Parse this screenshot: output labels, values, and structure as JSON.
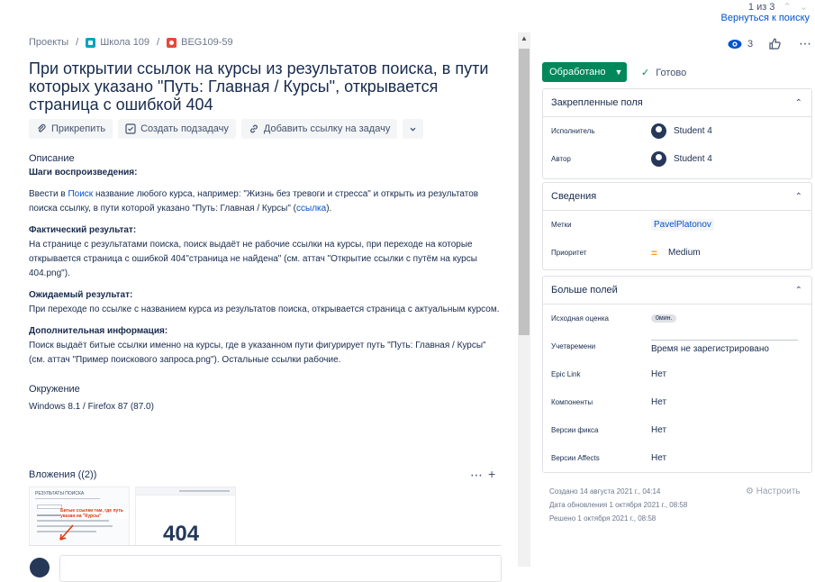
{
  "pager": {
    "position": "1 из 3",
    "back_label": "Вернуться к поиску"
  },
  "breadcrumb": {
    "projects": "Проекты",
    "project": "Школа 109",
    "issue_key": "BEG109-59"
  },
  "issue": {
    "title": "При открытии ссылок на курсы из результатов поиска, в пути которых указано \"Путь: Главная / Курсы\", открывается страница с ошибкой 404"
  },
  "actions": {
    "attach": "Прикрепить",
    "subtask": "Создать подзадачу",
    "link": "Добавить ссылку на задачу"
  },
  "description": {
    "heading": "Описание",
    "steps_heading": "Шаги воспроизведения:",
    "steps_1": "Ввести в ",
    "steps_link": "Поиск",
    "steps_2": " название любого курса, например: \"Жизнь без тревоги и стресса\" и открыть из результатов поиска ссылку, в пути которой указано \"Путь: Главная / Курсы\" (",
    "steps_link2": "ссылка",
    "steps_3": ").",
    "actual_heading": "Фактический результат:",
    "actual": "На странице с результатами поиска, поиск выдаёт не рабочие ссылки на курсы, при переходе на которые открывается страница с ошибкой 404\"страница не найдена\" (см. аттач \"Открытие ссылки с путём на курсы 404.png\").",
    "expected_heading": "Ожидаемый результат:",
    "expected": "При переходе по ссылке с названием курса из результатов поиска, открывается страница с актуальным курсом.",
    "extra_heading": "Дополнительная информация:",
    "extra": "Поиск выдаёт битые ссылки именно на курсы, где в указанном пути фигурирует путь \"Путь: Главная / Курсы\" (см. аттач \"Пример поискового запроса.png\"). Остальные ссылки рабочие."
  },
  "environment": {
    "heading": "Окружение",
    "value": "Windows 8.1 / Firefox 87 (87.0)"
  },
  "attachments": {
    "heading": "Вложения ((2))",
    "thumb1_title": "РЕЗУЛЬТАТЫ ПОИСКА",
    "thumb1_note": "Битые ссылки там, где путь указан на \"Курсы\"",
    "thumb2_code": "404"
  },
  "watchers": {
    "count": "3"
  },
  "status": {
    "label": "Обработано",
    "resolution": "Готово"
  },
  "pinned": {
    "heading": "Закрепленные поля",
    "assignee_label": "Исполнитель",
    "assignee": "Student 4",
    "author_label": "Автор",
    "author": "Student 4"
  },
  "details": {
    "heading": "Сведения",
    "labels_label": "Метки",
    "labels_value": "PavelPlatonov",
    "priority_label": "Приоритет",
    "priority_value": "Medium"
  },
  "more": {
    "heading": "Больше полей",
    "estimate_label": "Исходная оценка",
    "estimate_value": "0мин.",
    "time_label": "Учетвремени",
    "time_value": "Время не зарегистрировано",
    "epic_label": "Epic Link",
    "epic_value": "Нет",
    "components_label": "Компоненты",
    "components_value": "Нет",
    "fix_label": "Версии фикса",
    "fix_value": "Нет",
    "affects_label": "Версии Affects",
    "affects_value": "Нет"
  },
  "meta": {
    "created": "Создано 14 августа 2021 г., 04:14",
    "updated": "Дата обновления 1 октября 2021 г., 08:58",
    "resolved": "Решено 1 октября 2021 г., 08:58",
    "settings": "Настроить"
  },
  "colors": {
    "accent": "#0052cc",
    "status": "#00875a",
    "text": "#172b4d"
  }
}
